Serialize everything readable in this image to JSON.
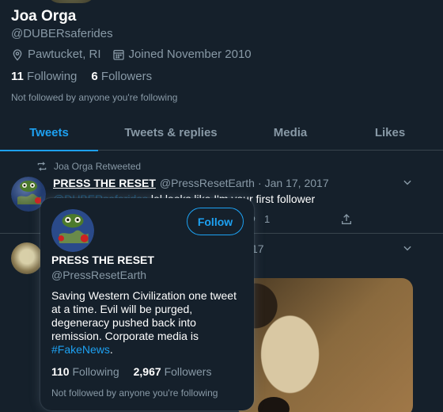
{
  "profile": {
    "name": "Joa Orga",
    "handle": "@DUBERsaferides",
    "location": "Pawtucket, RI",
    "joined": "Joined November 2010",
    "following_count": "11",
    "following_label": "Following",
    "followers_count": "6",
    "followers_label": "Followers",
    "not_followed": "Not followed by anyone you're following"
  },
  "tabs": [
    {
      "label": "Tweets",
      "active": true
    },
    {
      "label": "Tweets & replies",
      "active": false
    },
    {
      "label": "Media",
      "active": false
    },
    {
      "label": "Likes",
      "active": false
    }
  ],
  "tweet1": {
    "retweet_label": "Joa Orga Retweeted",
    "author_name": "PRESS THE RESET",
    "author_handle": "@PressResetEarth",
    "separator": "·",
    "date": "Jan 17, 2017",
    "text_mention": "@DUBERsaferides",
    "text_rest": " lol looks like I'm your first follower",
    "like_count": "1"
  },
  "tweet2": {
    "date_fragment": "17"
  },
  "hovercard": {
    "follow_label": "Follow",
    "name": "PRESS THE RESET",
    "handle": "@PressResetEarth",
    "bio_text": "Saving Western Civilization one tweet at a time. Evil will be purged, degeneracy pushed back into remission. Corporate media is ",
    "bio_hashtag": "#FakeNews",
    "bio_end": ".",
    "following_count": "110",
    "following_label": "Following",
    "followers_count": "2,967",
    "followers_label": "Followers",
    "not_followed": "Not followed by anyone you're following"
  },
  "colors": {
    "background": "#15202b",
    "accent": "#1da1f2",
    "muted": "#8899a6",
    "border": "#38444d"
  },
  "icons": [
    "location-icon",
    "calendar-icon",
    "retweet-icon",
    "chevron-down-icon",
    "like-icon",
    "share-icon"
  ]
}
